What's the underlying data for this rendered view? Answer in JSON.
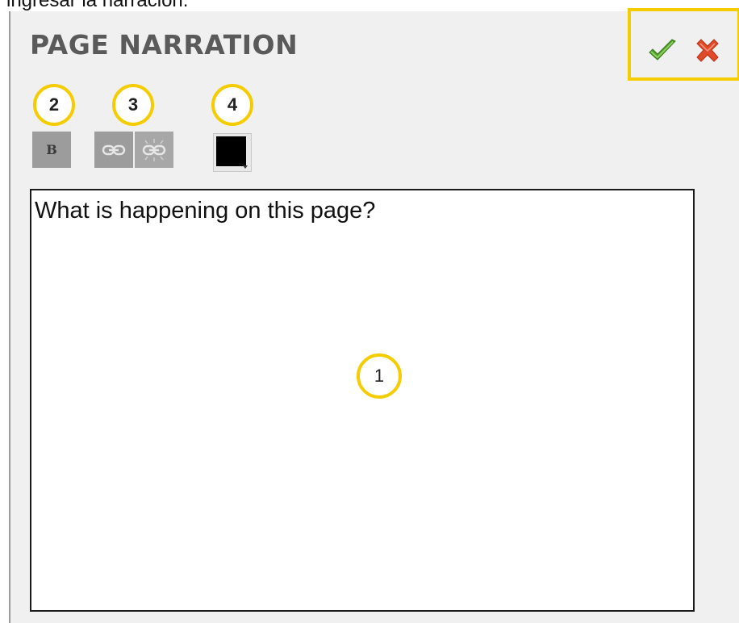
{
  "intro_text": "ingresar la narración:",
  "panel": {
    "title": "PAGE NARRATION",
    "narration_text": "What is happening on this page?"
  },
  "actions": {
    "confirm_icon": "checkmark-icon",
    "cancel_icon": "x-icon"
  },
  "toolbar": {
    "bold_label": "B",
    "link_icon": "link-icon",
    "unlink_icon": "unlink-icon",
    "text_color": "#000000"
  },
  "callouts": {
    "editor": "1",
    "bold": "2",
    "links": "3",
    "color": "4"
  },
  "colors": {
    "callout_ring": "#f5cc00",
    "confirm_green": "#4e9a2a",
    "cancel_red": "#e04a2a"
  }
}
